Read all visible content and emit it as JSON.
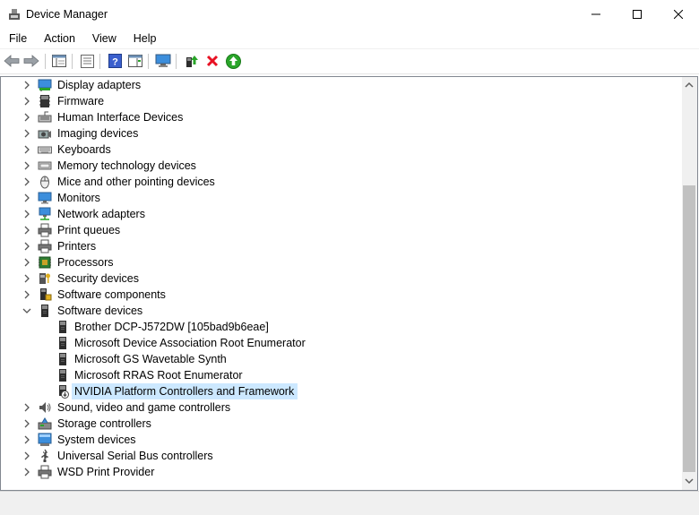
{
  "window": {
    "title": "Device Manager"
  },
  "menu": [
    "File",
    "Action",
    "View",
    "Help"
  ],
  "tree": {
    "categories": [
      {
        "label": "Display adapters",
        "icon": "display-adapter-icon",
        "expanded": false
      },
      {
        "label": "Firmware",
        "icon": "firmware-chip-icon",
        "expanded": false
      },
      {
        "label": "Human Interface Devices",
        "icon": "hid-icon",
        "expanded": false
      },
      {
        "label": "Imaging devices",
        "icon": "camera-icon",
        "expanded": false
      },
      {
        "label": "Keyboards",
        "icon": "keyboard-icon",
        "expanded": false
      },
      {
        "label": "Memory technology devices",
        "icon": "memory-icon",
        "expanded": false
      },
      {
        "label": "Mice and other pointing devices",
        "icon": "mouse-icon",
        "expanded": false
      },
      {
        "label": "Monitors",
        "icon": "monitor-icon",
        "expanded": false
      },
      {
        "label": "Network adapters",
        "icon": "network-icon",
        "expanded": false
      },
      {
        "label": "Print queues",
        "icon": "printer-icon",
        "expanded": false
      },
      {
        "label": "Printers",
        "icon": "printer-icon",
        "expanded": false
      },
      {
        "label": "Processors",
        "icon": "processor-icon",
        "expanded": false
      },
      {
        "label": "Security devices",
        "icon": "security-key-icon",
        "expanded": false
      },
      {
        "label": "Software components",
        "icon": "software-component-icon",
        "expanded": false
      },
      {
        "label": "Software devices",
        "icon": "software-device-icon",
        "expanded": true,
        "children": [
          {
            "label": "Brother DCP-J572DW [105bad9b6eae]",
            "icon": "software-device-icon"
          },
          {
            "label": "Microsoft Device Association Root Enumerator",
            "icon": "software-device-icon"
          },
          {
            "label": "Microsoft GS Wavetable Synth",
            "icon": "software-device-icon"
          },
          {
            "label": "Microsoft RRAS Root Enumerator",
            "icon": "software-device-icon"
          },
          {
            "label": "NVIDIA Platform Controllers and Framework",
            "icon": "software-device-warning-icon",
            "selected": true
          }
        ]
      },
      {
        "label": "Sound, video and game controllers",
        "icon": "speaker-icon",
        "expanded": false
      },
      {
        "label": "Storage controllers",
        "icon": "storage-icon",
        "expanded": false
      },
      {
        "label": "System devices",
        "icon": "system-device-icon",
        "expanded": false
      },
      {
        "label": "Universal Serial Bus controllers",
        "icon": "usb-icon",
        "expanded": false
      },
      {
        "label": "WSD Print Provider",
        "icon": "printer-icon",
        "expanded": false
      }
    ]
  },
  "colors": {
    "selection": "#cce8ff",
    "remove": "#e81123",
    "enable": "#2aa52a"
  }
}
